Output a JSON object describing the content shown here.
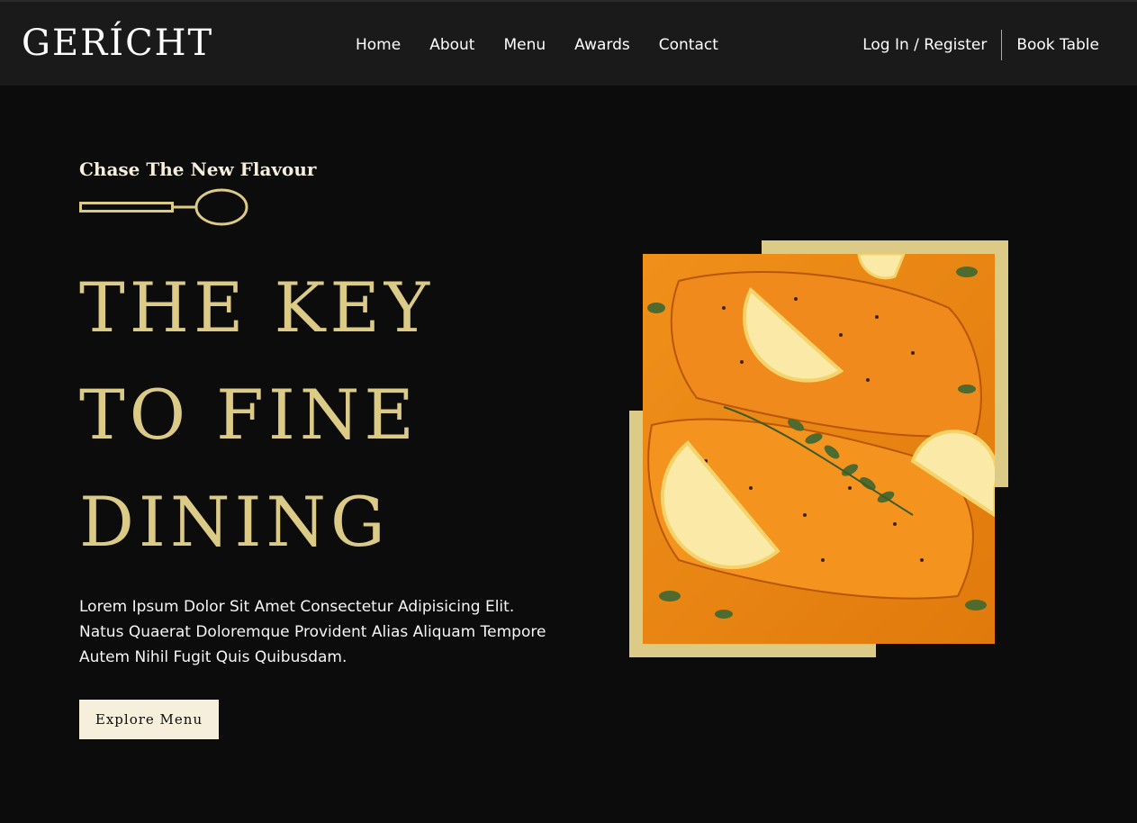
{
  "brand": {
    "logo_text": "GERÍCHT"
  },
  "nav": {
    "links": [
      "Home",
      "About",
      "Menu",
      "Awards",
      "Contact"
    ],
    "login_label": "Log In / Register",
    "book_label": "Book Table"
  },
  "hero": {
    "subtitle": "Chase The New Flavour",
    "headline_lines": [
      "THE KEY",
      "TO FINE",
      "DINING"
    ],
    "description": "Lorem Ipsum Dolor Sit Amet Consectetur Adipisicing Elit. Natus Quaerat Doloremque Provident Alias Aliquam Tempore Autem Nihil Fugit Quis Quibusdam.",
    "cta_label": "Explore Menu"
  },
  "colors": {
    "background": "#0c0c0c",
    "navbar": "#1a1a1a",
    "gold": "#dcca87",
    "cream": "#f5efdb"
  },
  "image": {
    "subject": "salmon-dish-photo"
  }
}
